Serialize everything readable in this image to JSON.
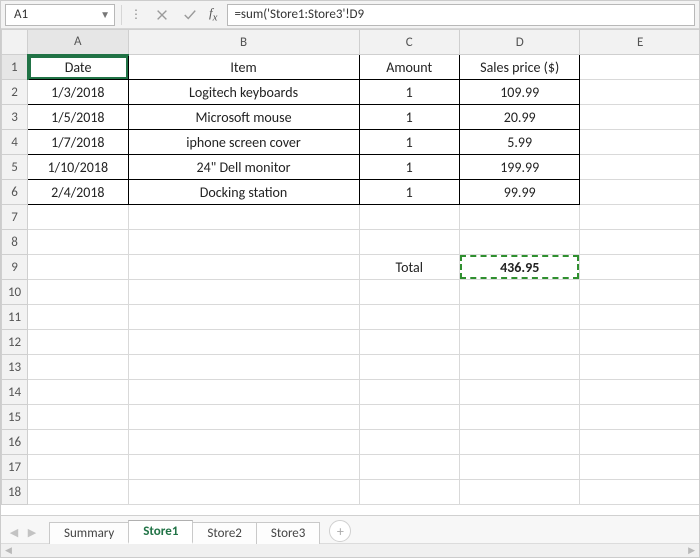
{
  "namebox": {
    "ref": "A1"
  },
  "formula_bar": {
    "value": "=sum('Store1:Store3'!D9"
  },
  "columns": [
    "A",
    "B",
    "C",
    "D",
    "E"
  ],
  "row_count": 18,
  "headers": {
    "A": "Date",
    "B": "Item",
    "C": "Amount",
    "D": "Sales price ($)"
  },
  "rows": [
    {
      "date": "1/3/2018",
      "item": "Logitech keyboards",
      "amount": "1",
      "price": "109.99"
    },
    {
      "date": "1/5/2018",
      "item": "Microsoft mouse",
      "amount": "1",
      "price": "20.99"
    },
    {
      "date": "1/7/2018",
      "item": "iphone screen cover",
      "amount": "1",
      "price": "5.99"
    },
    {
      "date": "1/10/2018",
      "item": "24\" Dell monitor",
      "amount": "1",
      "price": "199.99"
    },
    {
      "date": "2/4/2018",
      "item": "Docking station",
      "amount": "1",
      "price": "99.99"
    }
  ],
  "total": {
    "label": "Total",
    "value": "436.95"
  },
  "selection": {
    "cell": "A1",
    "copy_range": "D9"
  },
  "sheets": {
    "tabs": [
      "Summary",
      "Store1",
      "Store2",
      "Store3"
    ],
    "active": "Store1"
  },
  "chart_data": {
    "type": "table",
    "columns": [
      "Date",
      "Item",
      "Amount",
      "Sales price ($)"
    ],
    "data": [
      [
        "1/3/2018",
        "Logitech keyboards",
        1,
        109.99
      ],
      [
        "1/5/2018",
        "Microsoft mouse",
        1,
        20.99
      ],
      [
        "1/7/2018",
        "iphone screen cover",
        1,
        5.99
      ],
      [
        "1/10/2018",
        "24\" Dell monitor",
        1,
        199.99
      ],
      [
        "2/4/2018",
        "Docking station",
        1,
        99.99
      ]
    ],
    "total_label": "Total",
    "total_value": 436.95
  }
}
